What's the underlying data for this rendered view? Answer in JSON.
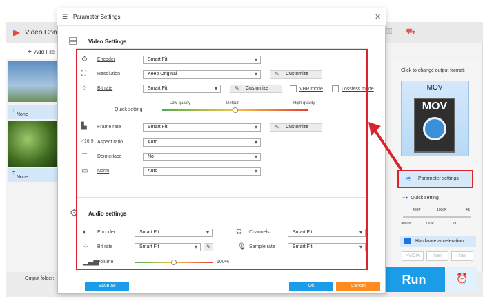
{
  "background_app": {
    "title": "Video Conv",
    "add_files": "Add File",
    "files": [
      {
        "subtitle": "None"
      },
      {
        "subtitle": "None"
      }
    ],
    "output_folder_label": "Output folder:",
    "right_panel": {
      "caption": "Click to change output format:",
      "format": "MOV",
      "format_icon_text": "MOV",
      "parameter_settings": "Parameter settings",
      "quick_setting": "Quick setting",
      "quick_top_ticks": [
        "480P",
        "1080P",
        "4K"
      ],
      "quick_bottom_ticks": [
        "Default",
        "720P",
        "2K"
      ],
      "hardware_acceleration": "Hardware acceleration",
      "chips": [
        "NVIDIA",
        "Intel",
        "Intel"
      ],
      "run": "Run"
    }
  },
  "dialog": {
    "title": "Parameter Settings",
    "video": {
      "title": "Video Settings",
      "encoder": {
        "label": "Encoder",
        "value": "Smart Fit"
      },
      "resolution": {
        "label": "Resolution",
        "value": "Keep Original",
        "customize": "Customize"
      },
      "bitrate": {
        "label": "Bit rate",
        "value": "Smart Fit",
        "customize": "Customize",
        "vbr": "VBR mode",
        "lossless": "Lossless mode"
      },
      "quick_setting": {
        "label": "Quick setting",
        "low": "Low quality",
        "default": "Default",
        "high": "High quality",
        "value": 0.5
      },
      "framerate": {
        "label": "Frame rate",
        "value": "Smart Fit",
        "customize": "Customize"
      },
      "aspect": {
        "label": "Aspect ratio",
        "value": "Auto"
      },
      "deinterlace": {
        "label": "Deinterlace",
        "value": "No"
      },
      "norm": {
        "label": "Norm",
        "value": "Auto"
      }
    },
    "audio": {
      "title": "Audio settings",
      "encoder": {
        "label": "Encoder",
        "value": "Smart Fit"
      },
      "channels": {
        "label": "Channels",
        "value": "Smart Fit"
      },
      "bitrate": {
        "label": "Bit rate",
        "value": "Smart Fit"
      },
      "samplerate": {
        "label": "Sample rate",
        "value": "Smart Fit"
      },
      "volume": {
        "label": "Volume",
        "value_text": "100%",
        "value": 0.5
      }
    },
    "footer": {
      "save_as": "Save as",
      "ok": "Ok",
      "cancel": "Cancel"
    }
  },
  "colors": {
    "accent_blue": "#1a9ce8",
    "cancel_orange": "#ff8a1f",
    "highlight_red": "#d9232d"
  }
}
